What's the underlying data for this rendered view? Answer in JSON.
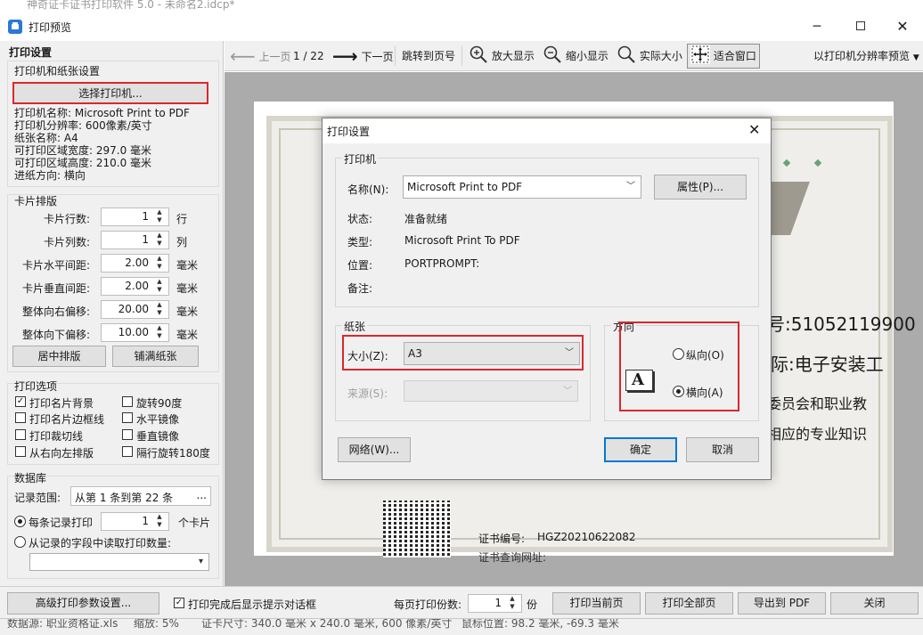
{
  "window": {
    "title": "打印预览",
    "bg_title": "神奇证卡证书打印软件 5.0 - 未命名2.idcp*"
  },
  "left": {
    "header": "打印设置",
    "printer_group": {
      "title": "打印机和纸张设置",
      "select_button": "选择打印机...",
      "info": [
        "打印机名称: Microsoft Print to PDF",
        "打印机分辨率: 600像素/英寸",
        "纸张名称: A4",
        "可打印区域宽度: 297.0 毫米",
        "可打印区域高度: 210.0 毫米",
        "进纸方向: 横向"
      ]
    },
    "layout_group": {
      "title": "卡片排版",
      "fields": [
        {
          "label": "卡片行数:",
          "value": "1",
          "unit": "行"
        },
        {
          "label": "卡片列数:",
          "value": "1",
          "unit": "列"
        },
        {
          "label": "卡片水平间距:",
          "value": "2.00",
          "unit": "毫米"
        },
        {
          "label": "卡片垂直间距:",
          "value": "2.00",
          "unit": "毫米"
        },
        {
          "label": "整体向右偏移:",
          "value": "20.00",
          "unit": "毫米"
        },
        {
          "label": "整体向下偏移:",
          "value": "10.00",
          "unit": "毫米"
        }
      ],
      "center_button": "居中排版",
      "fill_button": "铺满纸张"
    },
    "print_options": {
      "title": "打印选项",
      "left": [
        {
          "label": "打印名片背景",
          "checked": true
        },
        {
          "label": "打印名片边框线",
          "checked": false
        },
        {
          "label": "打印裁切线",
          "checked": false
        },
        {
          "label": "从右向左排版",
          "checked": false
        }
      ],
      "right": [
        {
          "label": "旋转90度",
          "checked": false
        },
        {
          "label": "水平镜像",
          "checked": false
        },
        {
          "label": "垂直镜像",
          "checked": false
        },
        {
          "label": "隔行旋转180度",
          "checked": false
        }
      ]
    },
    "database": {
      "title": "数据库",
      "range_label": "记录范围:",
      "range_value": "从第 1 条到第 22 条",
      "range_btn": "...",
      "each_record_label": "每条记录打印",
      "each_record_value": "1",
      "each_record_unit": "个卡片",
      "from_field_label": "从记录的字段中读取打印数量:"
    }
  },
  "toolbar": {
    "prev": "上一页",
    "page": "1 / 22",
    "next": "下一页",
    "jump": "跳转到页号",
    "zoom_in": "放大显示",
    "zoom_out": "缩小显示",
    "actual": "实际大小",
    "fit": "适合窗口",
    "resolution": "以打印机分辨率预览"
  },
  "preview": {
    "text1": "号:51052119900",
    "text2": "际:电子安装工",
    "text3": "委员会和职业教",
    "text4": "相应的专业知识",
    "cert_label": "证书编号:",
    "cert_value": "HGZ20210622082",
    "cut_text": "证书查询网址:"
  },
  "dialog": {
    "title": "打印设置",
    "printer_group": "打印机",
    "name_label": "名称(N):",
    "name_value": "Microsoft Print to PDF",
    "props_button": "属性(P)...",
    "status_label": "状态:",
    "status_value": "准备就绪",
    "type_label": "类型:",
    "type_value": "Microsoft Print To PDF",
    "where_label": "位置:",
    "where_value": "PORTPROMPT:",
    "comment_label": "备注:",
    "paper_group": "纸张",
    "size_label": "大小(Z):",
    "size_value": "A3",
    "source_label": "来源(S):",
    "orient_group": "方向",
    "portrait": "纵向(O)",
    "landscape": "横向(A)",
    "orient_icon": "A",
    "network_button": "网络(W)...",
    "ok_button": "确定",
    "cancel_button": "取消"
  },
  "bottom": {
    "advanced": "高级打印参数设置...",
    "show_prompt": "打印完成后显示提示对话框",
    "copies_label": "每页打印份数:",
    "copies_value": "1",
    "copies_unit": "份",
    "print_current": "打印当前页",
    "print_all": "打印全部页",
    "export_pdf": "导出到 PDF",
    "close": "关闭"
  },
  "status_bar": {
    "db": "数据源: 职业资格证.xls",
    "zoom": "缩放: 5%",
    "size": "证卡尺寸: 340.0 毫米 x 240.0 毫米, 600 像素/英寸",
    "mouse": "鼠标位置: 98.2 毫米, -69.3 毫米"
  },
  "colors": {
    "highlight_red": "#d9282f",
    "dialog_ok_border": "#0078d7",
    "preview_bg": "#ababab"
  }
}
